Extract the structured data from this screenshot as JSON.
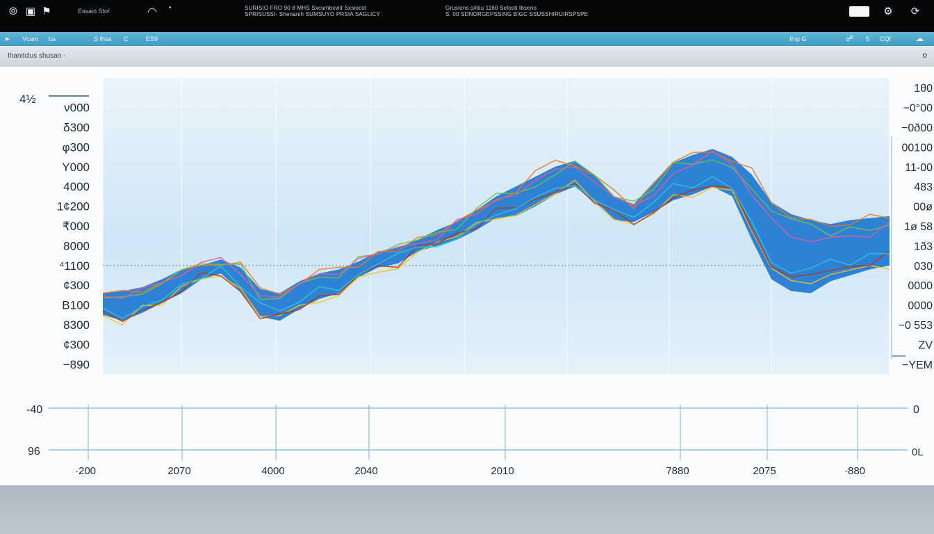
{
  "titlebar": {
    "app_name": "Essaio Sto/",
    "info_left_1": "SURISIO FRO 90 8 MHS Sxcumbxviit Sxsiocot",
    "info_left_2": "SPRISUSSI- Shenanih SUMSUYO PRSIA SAGLICY",
    "info_right_1": "Grusions silitiu 1160 Selosti Ibseno",
    "info_right_2": "S. 00 SDNORGEPSSING BIGC SSUSSHIRUIRSPSPE"
  },
  "toolbar": {
    "item_1": "Vcam",
    "item_2": "ba",
    "item_3": "S fhsa",
    "item_4": "C",
    "item_5": "ES9",
    "right_1": "Ifnp G",
    "right_2": "5",
    "right_3": "CQf"
  },
  "subbar": {
    "title": "Ihanitclus shusan -",
    "close_glyph": "o"
  },
  "colors": {
    "band": "#1f78d1",
    "series": [
      "#e87a1e",
      "#f2c21c",
      "#6fc04b",
      "#b2361a",
      "#e45a9c",
      "#2ec4d6"
    ]
  },
  "chart_data": {
    "type": "area",
    "title": "",
    "corner_label": "4½",
    "y_ticks_left": [
      {
        "value": 9000,
        "label": "ν000"
      },
      {
        "value": 8000,
        "label": "δ300"
      },
      {
        "value": 7000,
        "label": "φ300"
      },
      {
        "value": 6000,
        "label": "Υ000"
      },
      {
        "value": 5000,
        "label": "4000"
      },
      {
        "value": 4000,
        "label": "1¢200"
      },
      {
        "value": 3000,
        "label": "₹000"
      },
      {
        "value": 2000,
        "label": "8000"
      },
      {
        "value": 1000,
        "label": "⁴1100"
      },
      {
        "value": 0,
        "label": "¢300"
      },
      {
        "value": -1000,
        "label": "В100"
      },
      {
        "value": -2000,
        "label": "8300"
      },
      {
        "value": -3000,
        "label": "¢300"
      },
      {
        "value": -4000,
        "label": "−890"
      }
    ],
    "y_ticks_right": [
      {
        "value": 10000,
        "label": "1θ0"
      },
      {
        "value": 9000,
        "label": "−0°00"
      },
      {
        "value": 8000,
        "label": "−0ð00"
      },
      {
        "value": 7000,
        "label": "00100"
      },
      {
        "value": 6000,
        "label": "11-00"
      },
      {
        "value": 5000,
        "label": "483"
      },
      {
        "value": 4000,
        "label": "00ø"
      },
      {
        "value": 3000,
        "label": "1ø 58"
      },
      {
        "value": 2000,
        "label": "1ð3"
      },
      {
        "value": 1000,
        "label": "030"
      },
      {
        "value": 0,
        "label": "0000"
      },
      {
        "value": -1000,
        "label": "0000"
      },
      {
        "value": -2000,
        "label": "−0 553"
      },
      {
        "value": -3000,
        "label": "ΖV"
      },
      {
        "value": -4000,
        "label": "−YΕM"
      }
    ],
    "x_ticks": [
      "·200",
      "2070",
      "4000",
      "2040",
      "2010",
      "7880",
      "2075",
      "·880"
    ],
    "lower_axis_left": [
      "-40",
      "96"
    ],
    "lower_axis_right": [
      "0",
      "0L"
    ],
    "ylim": [
      -4500,
      10500
    ],
    "reference_line": 1000,
    "band": {
      "x": [
        0,
        2,
        4,
        6,
        8,
        10,
        12,
        14,
        16,
        18,
        20,
        22,
        24,
        26,
        28,
        30,
        32,
        34,
        36,
        38,
        40,
        42,
        44,
        46,
        48,
        50,
        52,
        54,
        56,
        58,
        60,
        62,
        64,
        66,
        68,
        70,
        72,
        74,
        76,
        78,
        80,
        82,
        84,
        86,
        88,
        90,
        92,
        94,
        96,
        98,
        100
      ],
      "upper": [
        -400,
        -300,
        -100,
        300,
        800,
        1000,
        1300,
        900,
        -200,
        -400,
        200,
        600,
        800,
        1200,
        1700,
        1900,
        2300,
        2800,
        3200,
        3800,
        4500,
        5000,
        5500,
        6000,
        6300,
        5600,
        4500,
        4100,
        5200,
        6200,
        6600,
        6900,
        6500,
        5600,
        4200,
        3600,
        3300,
        3100,
        3300,
        3400,
        3500
      ],
      "lower": [
        -1500,
        -1800,
        -1400,
        -900,
        -400,
        300,
        600,
        -300,
        -1600,
        -1800,
        -1200,
        -700,
        -400,
        400,
        900,
        1100,
        1700,
        2000,
        2300,
        2800,
        3400,
        3500,
        4000,
        4600,
        5000,
        4200,
        3300,
        3200,
        3700,
        4300,
        4600,
        5000,
        4500,
        2300,
        300,
        -300,
        -400,
        200,
        500,
        800,
        1000
      ]
    }
  }
}
